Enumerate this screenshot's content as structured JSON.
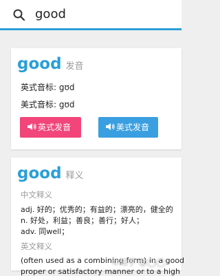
{
  "search": {
    "query": "good"
  },
  "pronunciation_card": {
    "word": "good",
    "subtitle": "发音",
    "uk_phonetic": "英式音标: gʊd",
    "us_phonetic": "美式音标: gʊd",
    "uk_button": "英式发音",
    "us_button": "美式发音"
  },
  "definition_card": {
    "word": "good",
    "subtitle": "释义",
    "chinese_heading": "中文释义",
    "chinese_lines": [
      "adj. 好的；优秀的；有益的；漂亮的，健全的",
      "n. 好处，利益；善良；善行；好人；",
      "adv. 同well；"
    ],
    "english_heading": "英文释义",
    "english_lines": [
      "(often used as a combining form) in a good",
      "proper or satisfactory manner or to a high"
    ]
  },
  "watermark": "©知乎 @◯◯",
  "colors": {
    "accent": "#2a9fd6",
    "uk_button": "#f2457a",
    "us_button": "#3a9fe0"
  }
}
